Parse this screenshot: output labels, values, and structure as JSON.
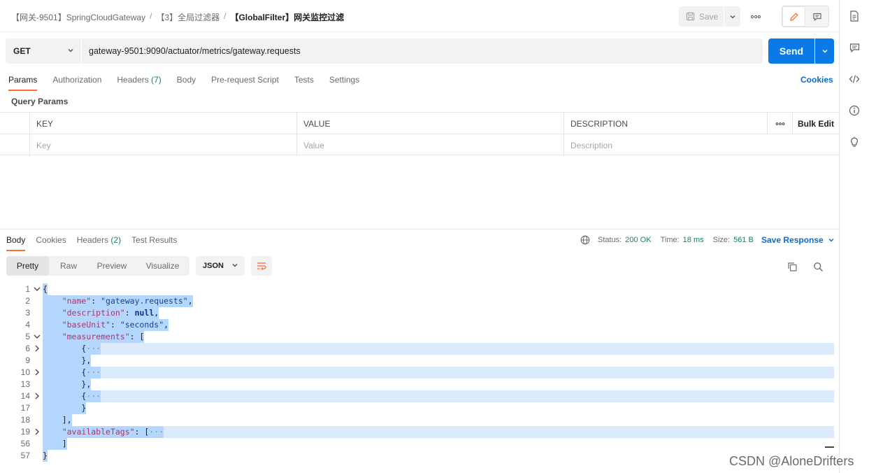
{
  "breadcrumb": {
    "items": [
      "【网关-9501】SpringCloudGateway",
      "【3】全局过滤器",
      "【GlobalFilter】网关监控过滤"
    ],
    "separator": "/"
  },
  "header": {
    "save_label": "Save"
  },
  "request": {
    "method": "GET",
    "url": "gateway-9501:9090/actuator/metrics/gateway.requests",
    "send_label": "Send",
    "tabs": [
      {
        "label": "Params",
        "count": ""
      },
      {
        "label": "Authorization",
        "count": ""
      },
      {
        "label": "Headers",
        "count": "(7)"
      },
      {
        "label": "Body",
        "count": ""
      },
      {
        "label": "Pre-request Script",
        "count": ""
      },
      {
        "label": "Tests",
        "count": ""
      },
      {
        "label": "Settings",
        "count": ""
      }
    ],
    "cookies_label": "Cookies",
    "query_params_title": "Query Params",
    "table": {
      "columns": [
        "KEY",
        "VALUE",
        "DESCRIPTION"
      ],
      "placeholders": [
        "Key",
        "Value",
        "Description"
      ],
      "bulk_edit_label": "Bulk Edit"
    }
  },
  "response": {
    "tabs": [
      {
        "label": "Body",
        "count": ""
      },
      {
        "label": "Cookies",
        "count": ""
      },
      {
        "label": "Headers",
        "count": "(2)"
      },
      {
        "label": "Test Results",
        "count": ""
      }
    ],
    "status_label": "Status:",
    "status_value": "200 OK",
    "time_label": "Time:",
    "time_value": "18 ms",
    "size_label": "Size:",
    "size_value": "561 B",
    "save_response_label": "Save Response",
    "views": [
      "Pretty",
      "Raw",
      "Preview",
      "Visualize"
    ],
    "format": "JSON",
    "code_lines": [
      {
        "n": "1",
        "fold": "down",
        "indent": "",
        "parts": [
          [
            "p",
            "{"
          ]
        ]
      },
      {
        "n": "2",
        "fold": "",
        "indent": "    ",
        "parts": [
          [
            "k",
            "\"name\""
          ],
          [
            "p",
            ": "
          ],
          [
            "s",
            "\"gateway.requests\""
          ],
          [
            "p",
            ","
          ]
        ]
      },
      {
        "n": "3",
        "fold": "",
        "indent": "    ",
        "parts": [
          [
            "k",
            "\"description\""
          ],
          [
            "p",
            ": "
          ],
          [
            "kw",
            "null"
          ],
          [
            "p",
            ","
          ]
        ]
      },
      {
        "n": "4",
        "fold": "",
        "indent": "    ",
        "parts": [
          [
            "k",
            "\"baseUnit\""
          ],
          [
            "p",
            ": "
          ],
          [
            "s",
            "\"seconds\""
          ],
          [
            "p",
            ","
          ]
        ]
      },
      {
        "n": "5",
        "fold": "down",
        "indent": "    ",
        "parts": [
          [
            "k",
            "\"measurements\""
          ],
          [
            "p",
            ": ["
          ]
        ]
      },
      {
        "n": "6",
        "fold": "right",
        "indent": "        ",
        "parts": [
          [
            "p",
            "{"
          ],
          [
            "ell",
            "···"
          ]
        ],
        "full": true
      },
      {
        "n": "9",
        "fold": "",
        "indent": "        ",
        "parts": [
          [
            "p",
            "},"
          ]
        ]
      },
      {
        "n": "10",
        "fold": "right",
        "indent": "        ",
        "parts": [
          [
            "p",
            "{"
          ],
          [
            "ell",
            "···"
          ]
        ],
        "full": true
      },
      {
        "n": "13",
        "fold": "",
        "indent": "        ",
        "parts": [
          [
            "p",
            "},"
          ]
        ]
      },
      {
        "n": "14",
        "fold": "right",
        "indent": "        ",
        "parts": [
          [
            "p",
            "{"
          ],
          [
            "ell",
            "···"
          ]
        ],
        "full": true
      },
      {
        "n": "17",
        "fold": "",
        "indent": "        ",
        "parts": [
          [
            "p",
            "}"
          ]
        ]
      },
      {
        "n": "18",
        "fold": "",
        "indent": "    ",
        "parts": [
          [
            "p",
            "],"
          ]
        ]
      },
      {
        "n": "19",
        "fold": "right",
        "indent": "    ",
        "parts": [
          [
            "k",
            "\"availableTags\""
          ],
          [
            "p",
            ": ["
          ],
          [
            "ell",
            "···"
          ]
        ],
        "full": true
      },
      {
        "n": "56",
        "fold": "",
        "indent": "    ",
        "parts": [
          [
            "p",
            "]"
          ]
        ]
      },
      {
        "n": "57",
        "fold": "",
        "indent": "",
        "parts": [
          [
            "p",
            "}"
          ]
        ]
      }
    ]
  },
  "watermark": "CSDN @AloneDrifters",
  "colors": {
    "accent": "#ff6c37",
    "send": "#0b7ae6",
    "link": "#0b6bcb",
    "status_ok": "#0a8a58",
    "selection": "#b3d7ff"
  },
  "icons": {
    "right_rail": [
      "document-icon",
      "comment-icon",
      "code-icon",
      "info-icon",
      "lightbulb-icon"
    ]
  }
}
